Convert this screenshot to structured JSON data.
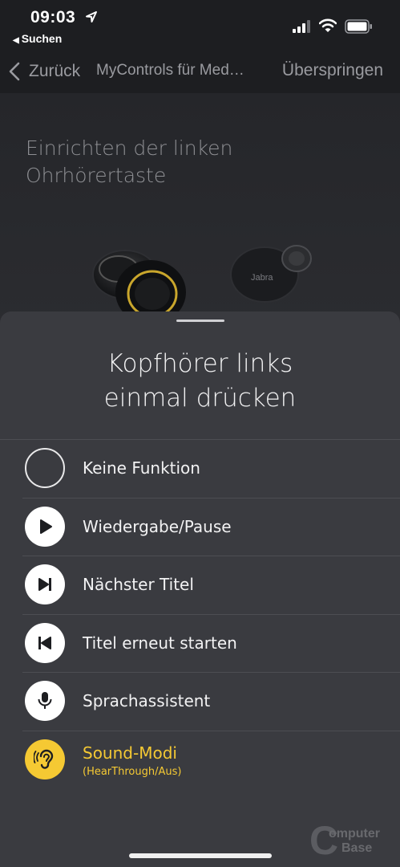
{
  "status_bar": {
    "time": "09:03",
    "back_app": "Suchen",
    "icons": [
      "location-arrow-icon",
      "signal-icon",
      "wifi-icon",
      "battery-icon"
    ]
  },
  "nav": {
    "back_label": "Zurück",
    "title": "MyControls für Med…",
    "skip_label": "Überspringen"
  },
  "setup": {
    "title": "Einrichten der linken Ohrhörertaste"
  },
  "sheet": {
    "title_line1": "Kopfhörer links",
    "title_line2": "einmal drücken",
    "options": [
      {
        "label": "Keine Funktion",
        "icon": "empty-circle-icon",
        "selected": false
      },
      {
        "label": "Wiedergabe/Pause",
        "icon": "play-icon",
        "selected": false
      },
      {
        "label": "Nächster Titel",
        "icon": "next-track-icon",
        "selected": false
      },
      {
        "label": "Titel erneut starten",
        "icon": "previous-track-icon",
        "selected": false
      },
      {
        "label": "Sprachassistent",
        "icon": "microphone-icon",
        "selected": false
      },
      {
        "label": "Sound-Modi",
        "sublabel": "(HearThrough/Aus)",
        "icon": "ear-icon",
        "selected": true
      }
    ]
  },
  "colors": {
    "accent": "#f5c933",
    "background": "#1d1e21",
    "sheet": "#3a3b40"
  },
  "watermark": {
    "line1": "omputer",
    "line2": "Base"
  }
}
